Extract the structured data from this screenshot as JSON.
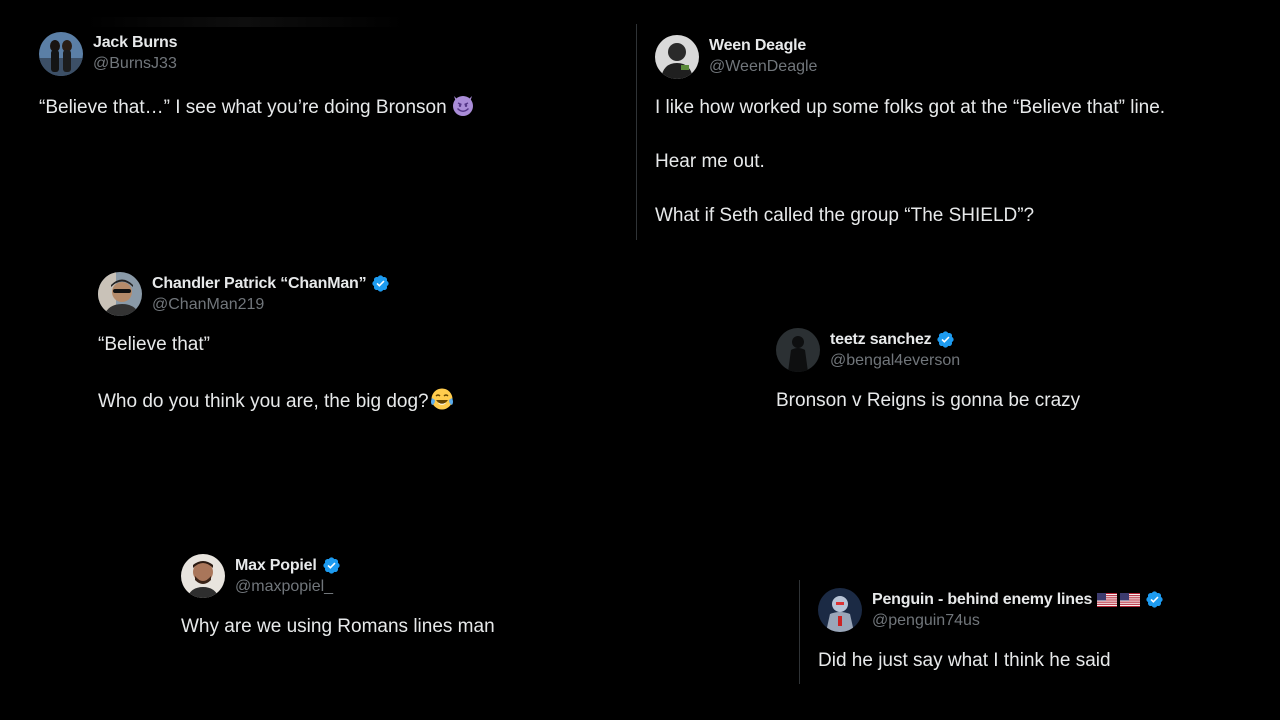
{
  "tweets": [
    {
      "name": "Jack Burns",
      "handle": "@BurnsJ33",
      "verified": false,
      "text": [
        "“Believe that…” I see what you’re doing Bronson"
      ],
      "emoji": "smiling-devil-emoji"
    },
    {
      "name": "Ween Deagle",
      "handle": "@WeenDeagle",
      "verified": false,
      "text": [
        "I like how worked up some folks got at the “Believe that” line.",
        "Hear me out.",
        "What if Seth called the group “The SHIELD”?"
      ]
    },
    {
      "name": "Chandler Patrick “ChanMan”",
      "handle": "@ChanMan219",
      "verified": true,
      "text": [
        "“Believe that”",
        "Who do you think you are, the big dog?"
      ],
      "emoji": "tears-of-joy-emoji"
    },
    {
      "name": "teetz sanchez",
      "handle": "@bengal4everson",
      "verified": true,
      "text": [
        "Bronson v Reigns is gonna be crazy"
      ]
    },
    {
      "name": "Max Popiel",
      "handle": "@maxpopiel_",
      "verified": true,
      "text": [
        "Why are we using Romans lines man"
      ]
    },
    {
      "name": "Penguin - behind enemy lines",
      "handle": "@penguin74us",
      "verified": true,
      "flags": [
        "us-flag-icon",
        "us-flag-icon"
      ],
      "text": [
        "Did he just say what I think he said"
      ]
    }
  ],
  "colors": {
    "background": "#000000",
    "text": "#e7e9ea",
    "handle": "#71767b",
    "verified": "#1d9bf0",
    "divider": "#2f3336"
  }
}
